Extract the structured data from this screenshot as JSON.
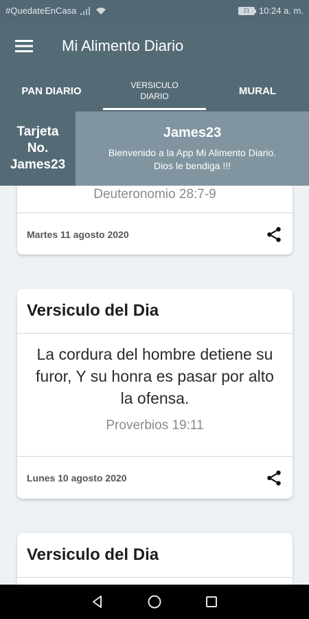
{
  "status_bar": {
    "hashtag": "#QuedateEnCasa",
    "battery": "21",
    "time": "10:24 a. m."
  },
  "app_bar": {
    "title": "Mi Alimento Diario",
    "menu_icon": "hamburger-menu-icon"
  },
  "tabs": [
    {
      "label": "PAN DIARIO",
      "active": false
    },
    {
      "label_line1": "VERSICULO",
      "label_line2": "DIARIO",
      "active": true
    },
    {
      "label": "MURAL",
      "active": false
    }
  ],
  "banner": {
    "card_line1": "Tarjeta",
    "card_line2": "No.",
    "card_line3": "James23",
    "user_name": "James23",
    "message_line1": "Bienvenido a la App Mi Alimento Diario.",
    "message_line2": "Dios le bendiga !!!"
  },
  "cards": [
    {
      "reference": "Deuteronomio 28:7-9",
      "date": "Martes 11 agosto 2020"
    },
    {
      "title": "Versiculo del Dia",
      "verse": "La cordura del hombre detiene su furor, Y su honra es pasar por alto la ofensa.",
      "reference": "Proverbios 19:11",
      "date": "Lunes 10 agosto 2020"
    },
    {
      "title": "Versiculo del Dia"
    }
  ],
  "colors": {
    "primary": "#546b76",
    "banner_message_bg": "#80959f",
    "background": "#eef1f3"
  }
}
